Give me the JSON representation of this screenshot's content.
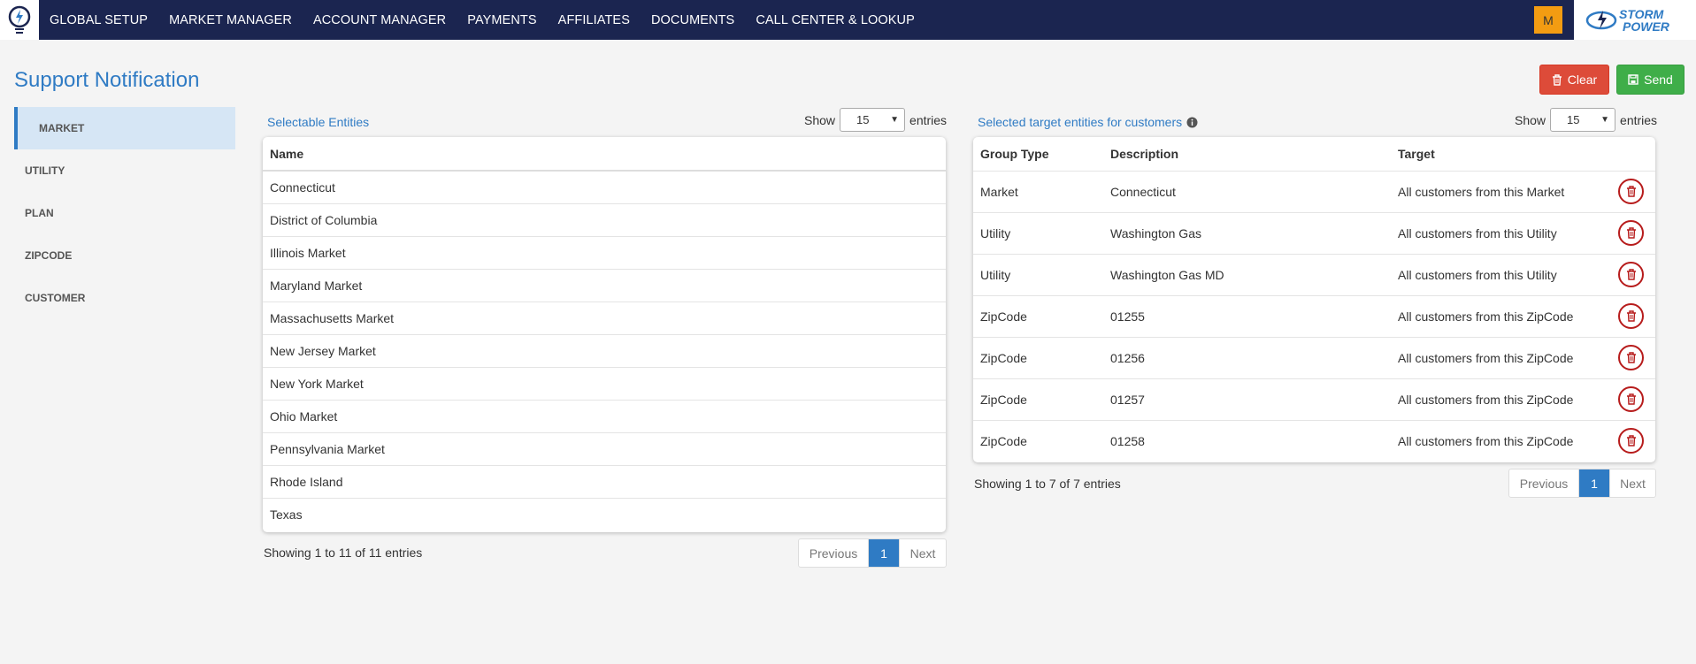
{
  "nav": {
    "items": [
      "GLOBAL SETUP",
      "MARKET MANAGER",
      "ACCOUNT MANAGER",
      "PAYMENTS",
      "AFFILIATES",
      "DOCUMENTS",
      "CALL CENTER & LOOKUP"
    ],
    "user_initial": "M",
    "logo_line1": "STORM",
    "logo_line2": "POWER"
  },
  "page": {
    "title": "Support Notification"
  },
  "actions": {
    "clear_label": "Clear",
    "send_label": "Send"
  },
  "sidebar": {
    "items": [
      "MARKET",
      "UTILITY",
      "PLAN",
      "ZIPCODE",
      "CUSTOMER"
    ],
    "active": "MARKET"
  },
  "left_panel": {
    "label": "Selectable Entities",
    "show_label": "Show",
    "entries_label": "entries",
    "page_size": "15",
    "column": "Name",
    "rows": [
      "Connecticut",
      "District of Columbia",
      "Illinois Market",
      "Maryland Market",
      "Massachusetts Market",
      "New Jersey Market",
      "New York Market",
      "Ohio Market",
      "Pennsylvania Market",
      "Rhode Island",
      "Texas"
    ],
    "info": "Showing 1 to 11 of 11 entries",
    "pager": {
      "prev": "Previous",
      "current": "1",
      "next": "Next"
    }
  },
  "right_panel": {
    "label": "Selected target entities for customers",
    "show_label": "Show",
    "entries_label": "entries",
    "page_size": "15",
    "columns": [
      "Group Type",
      "Description",
      "Target"
    ],
    "rows": [
      {
        "group": "Market",
        "description": "Connecticut",
        "target": "All customers from this Market"
      },
      {
        "group": "Utility",
        "description": "Washington Gas",
        "target": "All customers from this Utility"
      },
      {
        "group": "Utility",
        "description": "Washington Gas MD",
        "target": "All customers from this Utility"
      },
      {
        "group": "ZipCode",
        "description": "01255",
        "target": "All customers from this ZipCode"
      },
      {
        "group": "ZipCode",
        "description": "01256",
        "target": "All customers from this ZipCode"
      },
      {
        "group": "ZipCode",
        "description": "01257",
        "target": "All customers from this ZipCode"
      },
      {
        "group": "ZipCode",
        "description": "01258",
        "target": "All customers from this ZipCode"
      }
    ],
    "info": "Showing 1 to 7 of 7 entries",
    "pager": {
      "prev": "Previous",
      "current": "1",
      "next": "Next"
    }
  },
  "colors": {
    "nav_bg": "#1b2550",
    "accent": "#2f7bc4",
    "danger": "#dd4b39",
    "success": "#3fae49",
    "user_badge": "#f39c12"
  },
  "icons": {
    "brand": "bulb-logo-icon",
    "clear": "trash-icon",
    "send": "save-icon",
    "info": "info-icon",
    "row_delete": "trash-icon",
    "select": "chevron-down-icon"
  }
}
